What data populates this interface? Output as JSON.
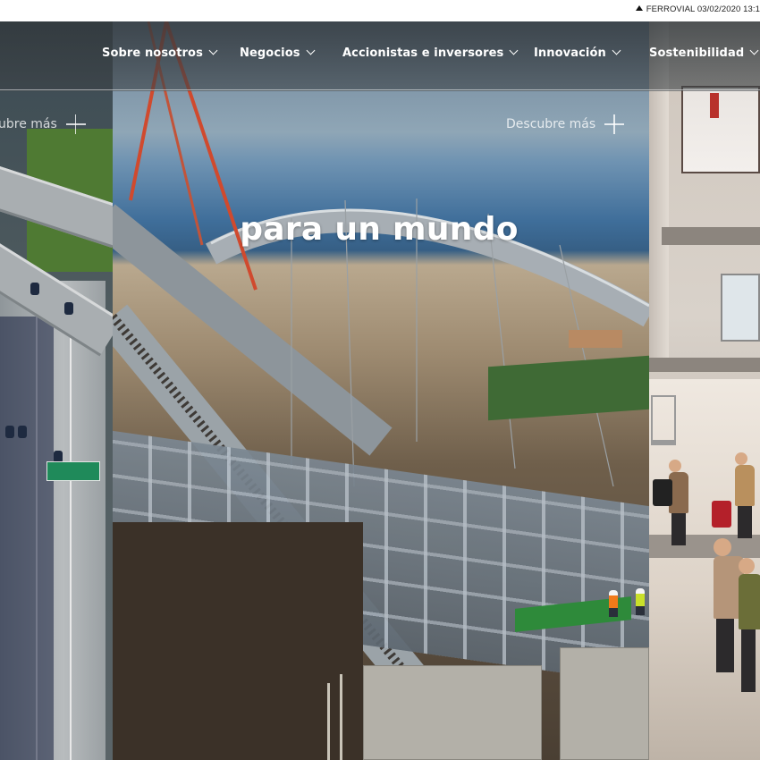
{
  "ticker": {
    "text": "FERROVIAL 03/02/2020 13:1"
  },
  "nav": {
    "items": [
      {
        "label": "Sobre nosotros"
      },
      {
        "label": "Negocios"
      },
      {
        "label": "Accionistas e inversores"
      },
      {
        "label": "Innovación"
      },
      {
        "label": "Sostenibilidad"
      }
    ]
  },
  "hero": {
    "panels": {
      "left": {
        "cta": "ubre más"
      },
      "center": {
        "cta": "Descubre más"
      }
    },
    "headline": "para un mundo"
  },
  "icons": {
    "ticker": "triangle-up-icon",
    "nav": "chevron-down-icon",
    "cta": "plus-icon"
  },
  "colors": {
    "nav_text": "#ffffff",
    "overlay": "#32383c",
    "ticker_text": "#222222"
  }
}
